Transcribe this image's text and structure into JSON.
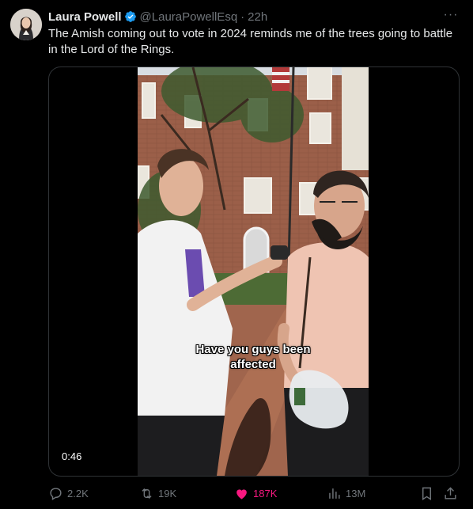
{
  "author": {
    "name": "Laura Powell",
    "handle": "@LauraPowellEsq",
    "separator": "·",
    "time": "22h",
    "verified_icon": "verified-badge-icon"
  },
  "tweet_text": "The Amish coming out to vote in 2024 reminds me of the trees going to battle in the Lord of the Rings.",
  "video": {
    "caption_line1": "Have you guys been",
    "caption_line2": "affected",
    "duration": "0:46"
  },
  "actions": {
    "replies": "2.2K",
    "reposts": "19K",
    "likes": "187K",
    "views": "13M"
  },
  "colors": {
    "background": "#000000",
    "text": "#e7e9ea",
    "muted": "#71767b",
    "verified": "#1d9bf0",
    "like": "#f91880"
  }
}
